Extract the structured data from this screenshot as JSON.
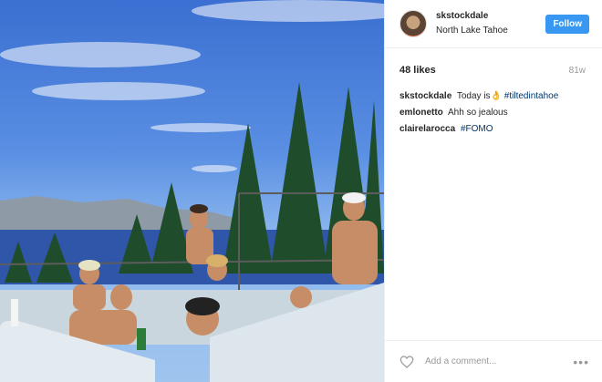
{
  "post": {
    "username": "skstockdale",
    "location": "North Lake Tahoe",
    "follow_label": "Follow",
    "likes": "48 likes",
    "time_ago": "81w"
  },
  "comments": [
    {
      "user": "skstockdale",
      "text": "Today is",
      "emoji": "👌",
      "hashtag": "#tiltedintahoe"
    },
    {
      "user": "emlonetto",
      "text": "Ahh so jealous",
      "emoji": "",
      "hashtag": ""
    },
    {
      "user": "clairelarocca",
      "text": "",
      "emoji": "",
      "hashtag": "#FOMO"
    }
  ],
  "footer": {
    "comment_placeholder": "Add a comment...",
    "more_label": "•••"
  },
  "icons": {
    "like": "heart-outline-icon",
    "options": "more-options-icon"
  },
  "colors": {
    "follow_button": "#3897f0",
    "hashtag": "#003569",
    "muted": "#999999"
  }
}
